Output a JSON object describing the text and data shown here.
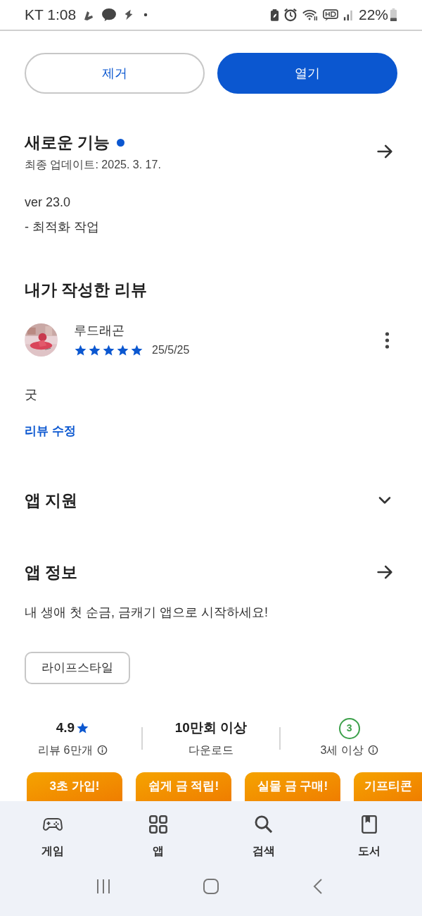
{
  "status_bar": {
    "carrier_time": "KT 1:08",
    "battery": "22%"
  },
  "actions": [
    {
      "label": "제거",
      "kind": "outline"
    },
    {
      "label": "열기",
      "kind": "filled"
    }
  ],
  "whats_new": {
    "title": "새로운 기능",
    "new_dot": true,
    "updated": "최종 업데이트: 2025. 3. 17.",
    "lines": [
      "ver 23.0",
      "- 최적화 작업"
    ]
  },
  "my_review": {
    "title": "내가 작성한 리뷰",
    "author": "루드래곤",
    "stars": 5,
    "date": "25/5/25",
    "text": "굿",
    "edit_link": "리뷰 수정"
  },
  "app_support": {
    "title": "앱 지원",
    "expanded": false
  },
  "app_info": {
    "title": "앱 정보",
    "description": "내 생애 첫 순금, 금캐기 앱으로 시작하세요!",
    "tags": [
      "라이프스타일"
    ]
  },
  "stats": [
    {
      "kind": "rating",
      "value": "4.9",
      "label": "리뷰 6만개"
    },
    {
      "kind": "downloads",
      "value": "10만회 이상",
      "label": "다운로드"
    },
    {
      "kind": "age",
      "value": "3",
      "label": "3세 이상"
    }
  ],
  "screenshots": [
    "3초 가입!",
    "쉽게 금 적립!",
    "실물 금 구매!",
    "기프티콘"
  ],
  "bottom_nav": [
    {
      "label": "게임",
      "selected": false
    },
    {
      "label": "앱",
      "selected": false
    },
    {
      "label": "검색",
      "selected": false
    },
    {
      "label": "도서",
      "selected": false
    }
  ]
}
